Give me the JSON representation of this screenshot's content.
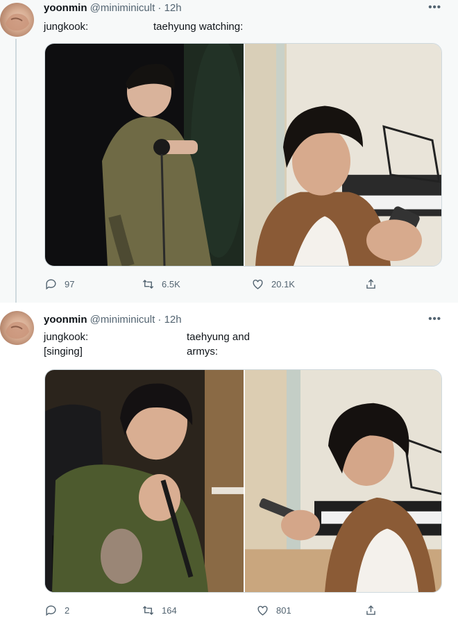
{
  "tweets": [
    {
      "display_name": "yoonmin",
      "handle": "@miniminicult",
      "separator": "·",
      "time": "12h",
      "more": "•••",
      "text_left": [
        "jungkook:"
      ],
      "text_right": [
        "taehyung watching:"
      ],
      "stats": {
        "replies": "97",
        "retweets": "6.5K",
        "likes": "20.1K"
      }
    },
    {
      "display_name": "yoonmin",
      "handle": "@miniminicult",
      "separator": "·",
      "time": "12h",
      "more": "•••",
      "text_left": [
        "jungkook:",
        "[singing]"
      ],
      "text_right": [
        "taehyung and",
        "armys:"
      ],
      "stats": {
        "replies": "2",
        "retweets": "164",
        "likes": "801"
      }
    }
  ],
  "icons": [
    "reply-icon",
    "retweet-icon",
    "like-icon",
    "share-icon",
    "more-icon"
  ],
  "colors": {
    "text_primary": "#0f1419",
    "text_secondary": "#536471",
    "border": "#cfd9de"
  }
}
